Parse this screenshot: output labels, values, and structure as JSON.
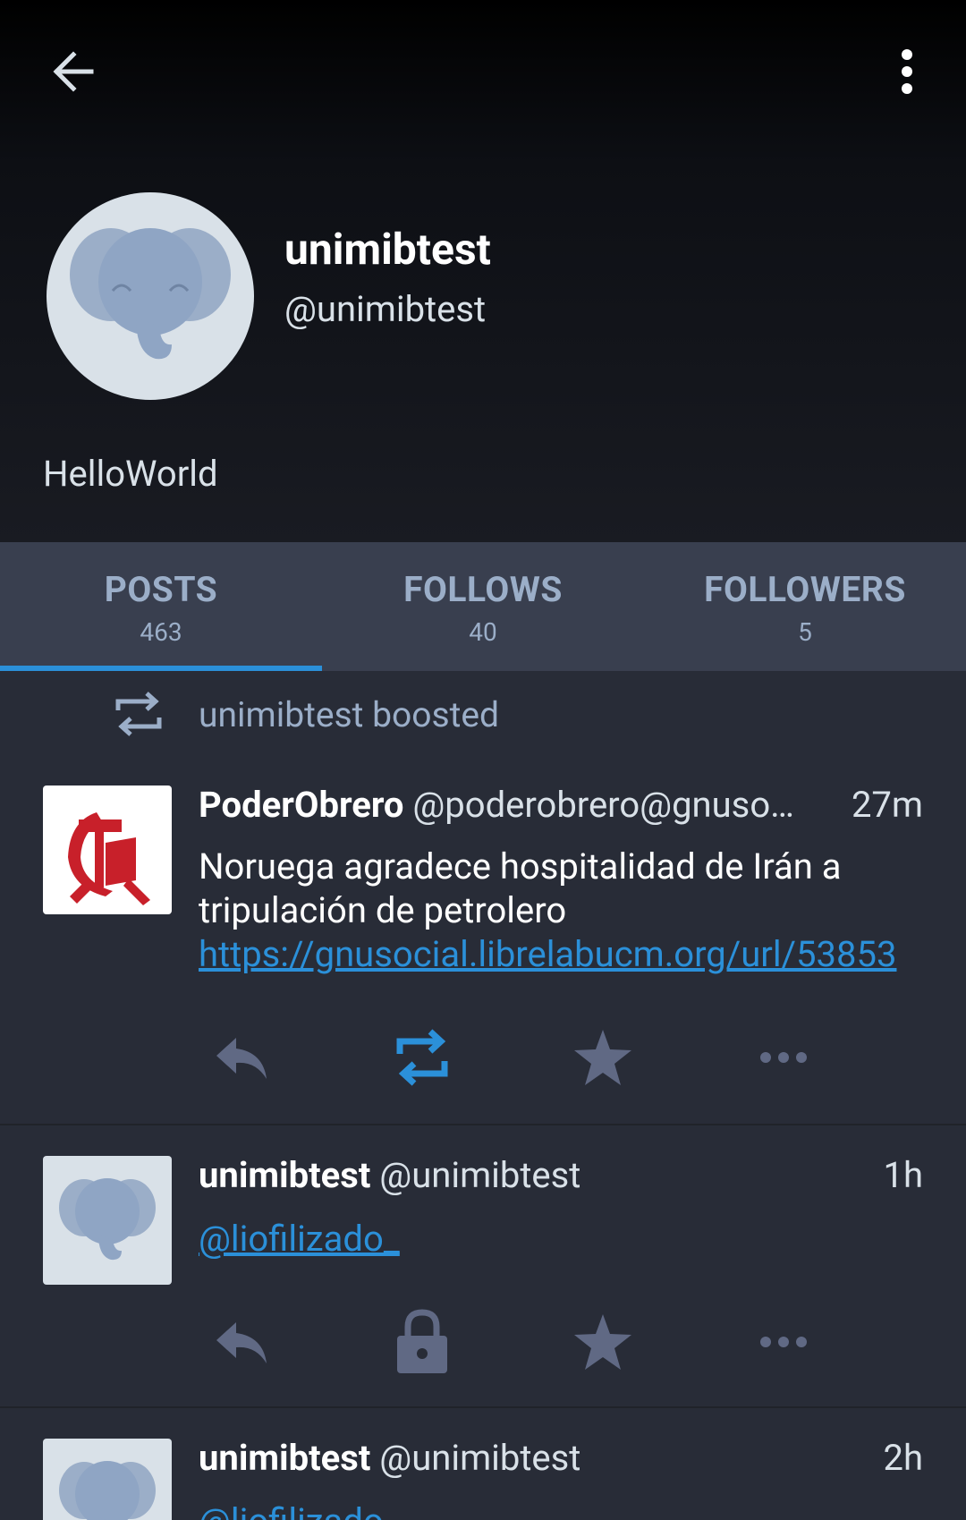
{
  "profile": {
    "display_name": "unimibtest",
    "handle": "@unimibtest",
    "bio": "HelloWorld"
  },
  "tabs": [
    {
      "label": "POSTS",
      "count": "463",
      "active": true
    },
    {
      "label": "FOLLOWS",
      "count": "40",
      "active": false
    },
    {
      "label": "FOLLOWERS",
      "count": "5",
      "active": false
    }
  ],
  "statuses": [
    {
      "boost_label": "unimibtest boosted",
      "name": "PoderObrero",
      "handle": "@poderobrero@gnuso…",
      "time": "27m",
      "text": "Noruega agradece hospitalidad de Irán a tripulación de petrolero ",
      "link": "https://gnusocial.librelabucm.org/url/53853",
      "avatar_icon": "hammer-sickle-icon",
      "reblog_icon": "boost-icon-active"
    },
    {
      "name": "unimibtest",
      "handle": "@unimibtest",
      "time": "1h",
      "mention": "@liofilizado_",
      "avatar_icon": "elephant-icon",
      "reblog_icon": "lock-icon"
    },
    {
      "name": "unimibtest",
      "handle": "@unimibtest",
      "time": "2h",
      "mention": "@liofilizado_",
      "avatar_icon": "elephant-icon"
    }
  ],
  "colors": {
    "accent": "#2b90d9",
    "background": "#282c37",
    "tab_bar": "#393f4f",
    "muted": "#9baec8",
    "icon": "#606984"
  }
}
